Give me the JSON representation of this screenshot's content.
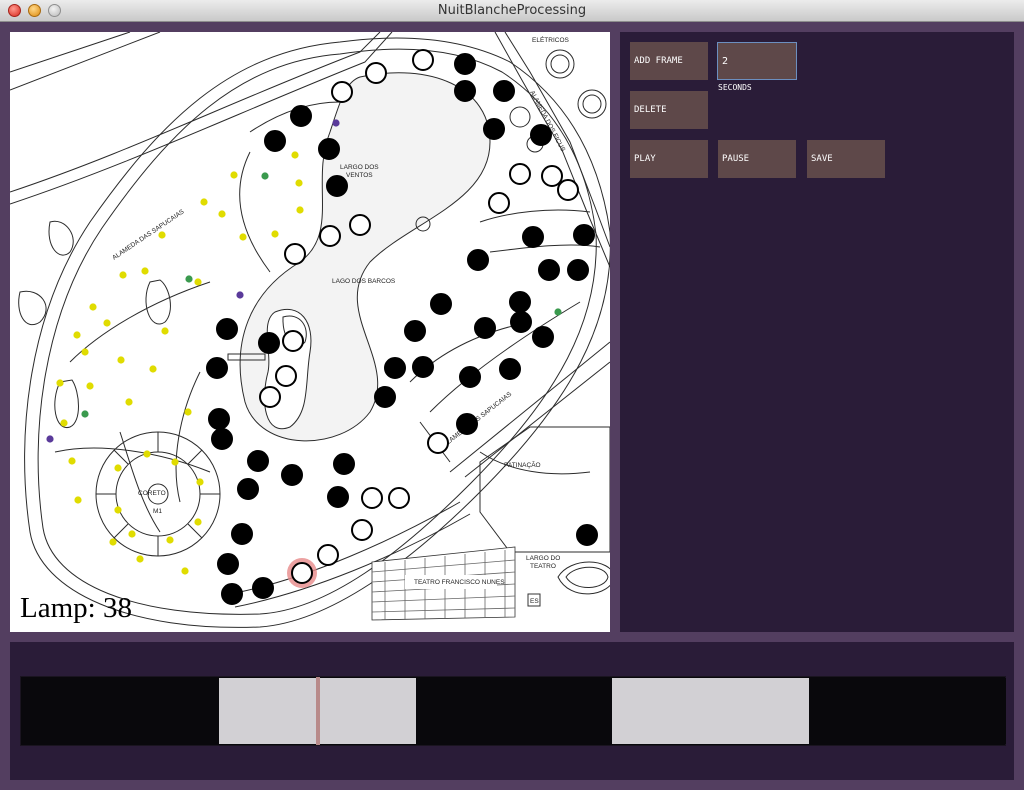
{
  "window": {
    "title": "NuitBlancheProcessing"
  },
  "map": {
    "labels": {
      "largo_ventos": [
        "LARGO DOS",
        "VENTOS"
      ],
      "lago_barcos": "LAGO DOS BARCOS",
      "alameda_ficus": "ALAMEDA DOS FICUS",
      "alameda_sapucaias_left": "ALAMEDA DAS SAPUCAIAS",
      "alameda_sapucaias_right": "ALAMEDA DAS SAPUCAIAS",
      "patinacao": "PATINAÇÃO",
      "coreto": "CORETO",
      "m1": "M1",
      "teatro": "TEATRO FRANCISCO NUNES",
      "largo_teatro": [
        "LARGO DO",
        "TEATRO"
      ],
      "eletricos": "ELÉTRICOS",
      "es": "ES"
    },
    "lamp_label": "Lamp: 38"
  },
  "controls": {
    "add_frame": "ADD FRAME",
    "seconds_value": "2",
    "seconds_label": "SECONDS",
    "delete": "DELETE",
    "play": "PLAY",
    "pause": "PAUSE",
    "save": "SAVE"
  },
  "timeline": {
    "frames": [
      "dark",
      "light",
      "dark",
      "light",
      "dark"
    ],
    "playhead_fraction": 0.3
  },
  "colors": {
    "background": "#533e60",
    "panel": "#2a1c38",
    "button": "#5e4849",
    "lamp_on": "#000000",
    "lamp_off": "#ffffff",
    "lamp_selected": "#e78a8a",
    "dot_yellow": "#e0dc00",
    "dot_green": "#3a9a4e",
    "dot_purple": "#5a3a9a"
  }
}
